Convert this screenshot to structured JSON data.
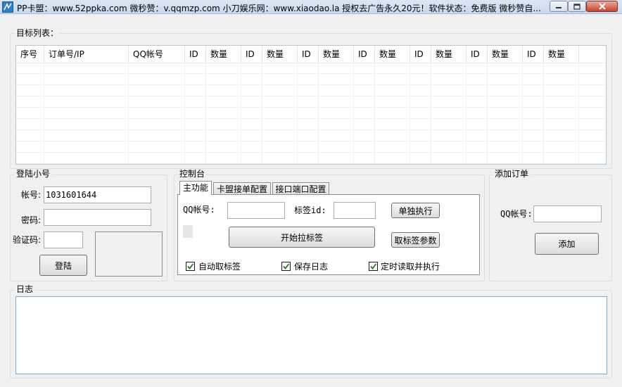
{
  "window": {
    "title": "PP卡盟：www.52ppka.com  微秒赞：v.qqmzp.com  小刀娱乐网：www.xiaodao.la 授权去广告永久20元！软件状态：免费版 微秒赞自..."
  },
  "target_list": {
    "legend": "目标列表：",
    "columns": [
      "序号",
      "订单号/IP",
      "QQ帐号",
      "ID",
      "数量",
      "ID",
      "数量",
      "ID",
      "数量",
      "ID",
      "数量",
      "ID",
      "数量",
      "ID",
      "数量",
      "ID",
      "数量"
    ]
  },
  "login": {
    "legend": "登陆小号",
    "account_label": "帐号:",
    "account_value": "1031601644",
    "password_label": "密码:",
    "password_value": "",
    "captcha_label": "验证码:",
    "captcha_value": "",
    "login_button": "登陆"
  },
  "console": {
    "legend": "控制台",
    "tabs": [
      {
        "label": "主功能",
        "active": true
      },
      {
        "label": "卡盟接单配置",
        "active": false
      },
      {
        "label": "接口端口配置",
        "active": false
      }
    ],
    "qq_label": "QQ帐号:",
    "qq_value": "",
    "tag_id_label": "标签id:",
    "tag_id_value": "",
    "single_exec_button": "单独执行",
    "start_button": "开始拉标签",
    "fetch_params_button": "取标签参数",
    "checkboxes": [
      {
        "label": "自动取标签",
        "checked": true
      },
      {
        "label": "保存日志",
        "checked": true
      },
      {
        "label": "定时读取并执行",
        "checked": true
      }
    ]
  },
  "add_order": {
    "legend": "添加订单",
    "qq_label": "QQ帐号:",
    "qq_value": "",
    "add_button": "添加"
  },
  "log": {
    "legend": "日志",
    "content": ""
  }
}
